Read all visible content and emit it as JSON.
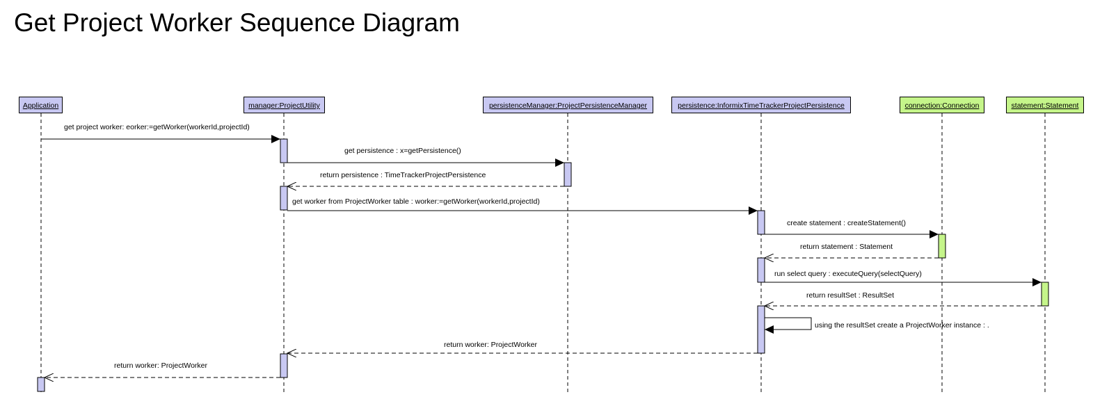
{
  "title": "Get Project Worker Sequence Diagram",
  "participants": [
    {
      "id": "app",
      "label": "Application",
      "color": "#c8c8f2"
    },
    {
      "id": "util",
      "label": "manager:ProjectUtility",
      "color": "#c8c8f2"
    },
    {
      "id": "pm",
      "label": "persistenceManager:ProjectPersistenceManager",
      "color": "#c8c8f2"
    },
    {
      "id": "pers",
      "label": "persistence:InformixTimeTrackerProjectPersistence",
      "color": "#c8c8f2"
    },
    {
      "id": "conn",
      "label": "connection:Connection",
      "color": "#c5f58a"
    },
    {
      "id": "stmt",
      "label": "statement:Statement",
      "color": "#c5f58a"
    }
  ],
  "messages": [
    {
      "from": "app",
      "to": "util",
      "type": "call",
      "label": "get project worker: eorker:=getWorker(workerId,projectId)"
    },
    {
      "from": "util",
      "to": "pm",
      "type": "call",
      "label": "get persistence : x=getPersistence()"
    },
    {
      "from": "pm",
      "to": "util",
      "type": "return",
      "label": "return persistence : TimeTrackerProjectPersistence"
    },
    {
      "from": "util",
      "to": "pers",
      "type": "call",
      "label": "get worker from ProjectWorker table : worker:=getWorker(workerId,projectId)"
    },
    {
      "from": "pers",
      "to": "conn",
      "type": "call",
      "label": "create statement : createStatement()"
    },
    {
      "from": "conn",
      "to": "pers",
      "type": "return",
      "label": "return statement : Statement"
    },
    {
      "from": "pers",
      "to": "stmt",
      "type": "call",
      "label": "run select query : executeQuery(selectQuery)"
    },
    {
      "from": "stmt",
      "to": "pers",
      "type": "return",
      "label": "return resultSet : ResultSet"
    },
    {
      "from": "pers",
      "to": "pers",
      "type": "self",
      "label": "using the resultSet create a ProjectWorker instance : ."
    },
    {
      "from": "pers",
      "to": "util",
      "type": "return",
      "label": "return worker: ProjectWorker"
    },
    {
      "from": "util",
      "to": "app",
      "type": "return",
      "label": "return worker: ProjectWorker"
    }
  ]
}
